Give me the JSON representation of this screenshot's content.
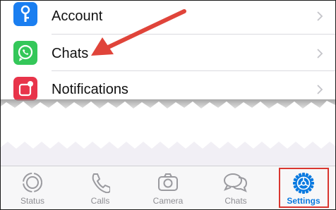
{
  "settings": {
    "items": [
      {
        "label": "Account",
        "icon": "key-icon",
        "color": "#1a7ef0"
      },
      {
        "label": "Chats",
        "icon": "whatsapp-chat-icon",
        "color": "#34c759"
      },
      {
        "label": "Notifications",
        "icon": "notification-icon",
        "color": "#e8344a"
      }
    ]
  },
  "tabbar": {
    "tabs": [
      {
        "label": "Status",
        "icon": "status-icon",
        "active": false
      },
      {
        "label": "Calls",
        "icon": "phone-icon",
        "active": false
      },
      {
        "label": "Camera",
        "icon": "camera-icon",
        "active": false
      },
      {
        "label": "Chats",
        "icon": "chat-bubbles-icon",
        "active": false
      },
      {
        "label": "Settings",
        "icon": "gear-icon",
        "active": true
      }
    ]
  },
  "colors": {
    "active_tab": "#0a7ae0",
    "inactive_tab": "#8e8e93",
    "annotation_red": "#d9362f"
  }
}
